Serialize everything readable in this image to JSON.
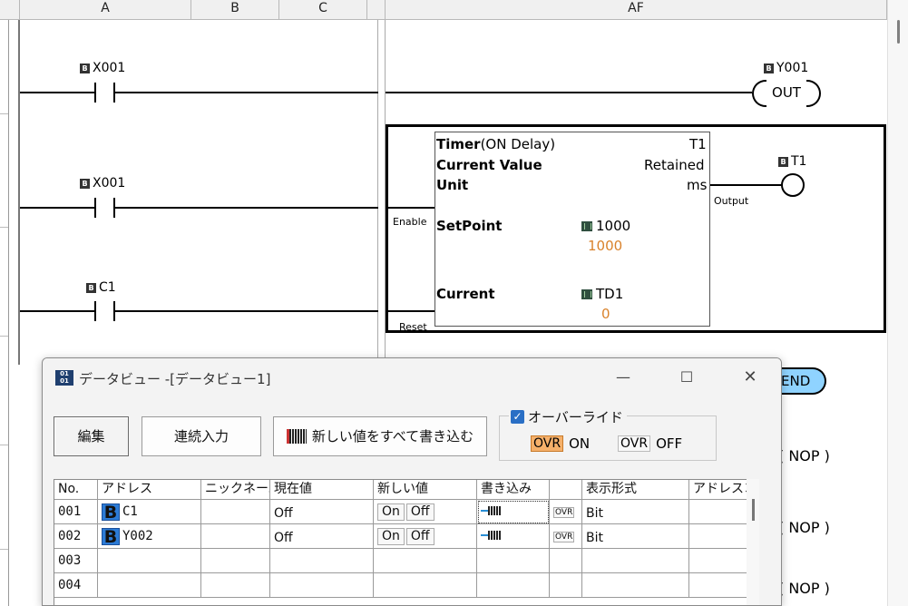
{
  "columns": {
    "a": "A",
    "b": "B",
    "c": "C",
    "af": "AF"
  },
  "rungs": {
    "r1": {
      "contact": "X001",
      "coil_device": "Y001",
      "coil_label": "OUT"
    },
    "r2": {
      "contact": "X001"
    },
    "r3": {
      "contact": "C1"
    }
  },
  "timer": {
    "title_bold": "Timer",
    "title_rest": "(ON Delay)",
    "name": "T1",
    "current_value_label": "Current Value",
    "current_value": "Retained",
    "unit_label": "Unit",
    "unit_value": "ms",
    "setpoint_label": "SetPoint",
    "setpoint_device": "1000",
    "setpoint_value": "1000",
    "current_label": "Current",
    "current_device": "TD1",
    "current_monitor": "0",
    "enable_label": "Enable",
    "reset_label": "Reset",
    "output_label": "Output",
    "output_device": "T1"
  },
  "end_label": "END",
  "nop_label": "( NOP )",
  "dialog": {
    "title": "データビュー -[データビュー1]",
    "buttons": {
      "edit": "編集",
      "continuous": "連続入力",
      "write_all": "新しい値をすべて書き込む"
    },
    "override": {
      "label": "オーバーライド",
      "on_badge": "OVR",
      "on_text": "ON",
      "off_badge": "OVR",
      "off_text": "OFF"
    },
    "headers": {
      "no": "No.",
      "address": "アドレス",
      "nickname": "ニックネーム",
      "current": "現在値",
      "new_value": "新しい値",
      "write": "書き込み",
      "format": "表示形式",
      "addr_comment": "アドレスコ"
    },
    "rows": [
      {
        "no": "001",
        "address": "C1",
        "current": "Off",
        "on": "On",
        "off": "Off",
        "ovr": "OVR",
        "format": "Bit"
      },
      {
        "no": "002",
        "address": "Y002",
        "current": "Off",
        "on": "On",
        "off": "Off",
        "ovr": "OVR",
        "format": "Bit"
      },
      {
        "no": "003"
      },
      {
        "no": "004"
      }
    ]
  }
}
